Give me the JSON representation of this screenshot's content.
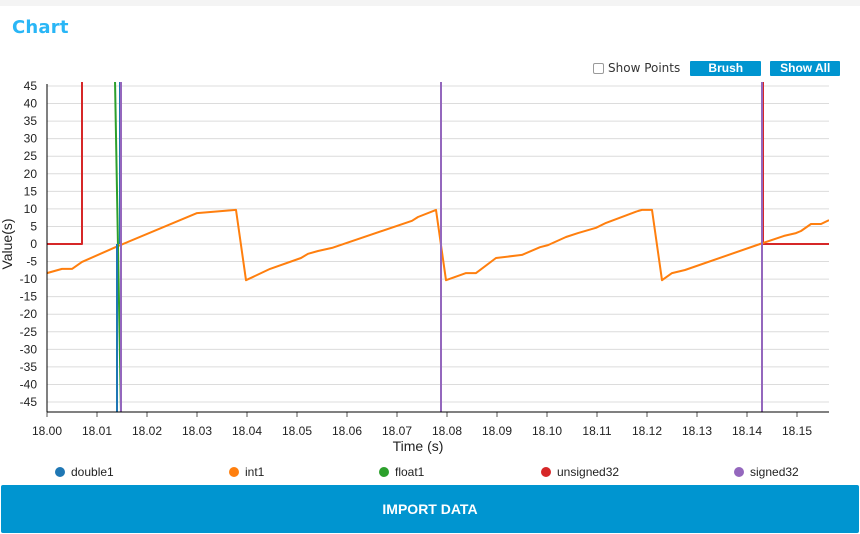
{
  "page": {
    "title": "Chart",
    "controls": {
      "show_points_label": "Show Points",
      "show_points_checked": false,
      "brush_label": "Brush",
      "show_all_label": "Show All"
    },
    "import_button_label": "IMPORT DATA"
  },
  "colors": {
    "accent": "#0095d0",
    "title": "#29b6f6"
  },
  "chart_data": {
    "type": "line",
    "title": "",
    "xlabel": "Time (s)",
    "ylabel": "Value(s)",
    "xlim": [
      18.0,
      18.1564
    ],
    "ylim": [
      -48,
      45
    ],
    "x_ticks": [
      "18.00",
      "18.01",
      "18.02",
      "18.03",
      "18.04",
      "18.05",
      "18.06",
      "18.07",
      "18.08",
      "18.09",
      "18.10",
      "18.11",
      "18.12",
      "18.13",
      "18.14",
      "18.15"
    ],
    "y_ticks": [
      "45",
      "40",
      "35",
      "30",
      "25",
      "20",
      "15",
      "10",
      "5",
      "0",
      "-5",
      "-10",
      "-15",
      "-20",
      "-25",
      "-30",
      "-35",
      "-40",
      "-45"
    ],
    "grid": "horizontal",
    "legend_position": "bottom",
    "series": [
      {
        "name": "double1",
        "color": "#1f77b4",
        "segments": [
          [
            [
              18.014,
              -48
            ],
            [
              18.014,
              0
            ]
          ],
          [
            [
              18.0146,
              0
            ],
            [
              18.0146,
              45
            ]
          ]
        ]
      },
      {
        "name": "int1",
        "color": "#ff7f0e",
        "segments": [
          [
            [
              18.0,
              -8.3
            ],
            [
              18.003,
              -7.1
            ],
            [
              18.005,
              -7.1
            ],
            [
              18.007,
              -5.1
            ],
            [
              18.0142,
              -0.6
            ],
            [
              18.03,
              8.8
            ],
            [
              18.0378,
              9.7
            ],
            [
              18.0398,
              -10.3
            ],
            [
              18.0446,
              -7.1
            ],
            [
              18.0508,
              -4.0
            ],
            [
              18.0522,
              -2.8
            ],
            [
              18.0542,
              -2.0
            ],
            [
              18.057,
              -1.1
            ],
            [
              18.073,
              6.6
            ],
            [
              18.0742,
              7.7
            ],
            [
              18.0778,
              9.7
            ],
            [
              18.0798,
              -10.3
            ],
            [
              18.0838,
              -8.3
            ],
            [
              18.0858,
              -8.3
            ],
            [
              18.0898,
              -4.0
            ],
            [
              18.095,
              -3.1
            ],
            [
              18.0986,
              -0.9
            ],
            [
              18.1002,
              -0.3
            ],
            [
              18.1038,
              2.0
            ],
            [
              18.1062,
              3.1
            ],
            [
              18.1098,
              4.6
            ],
            [
              18.1118,
              6.0
            ],
            [
              18.1182,
              9.4
            ],
            [
              18.119,
              9.7
            ],
            [
              18.121,
              9.7
            ],
            [
              18.123,
              -10.3
            ],
            [
              18.125,
              -8.3
            ],
            [
              18.1276,
              -7.4
            ],
            [
              18.1426,
              0.0
            ],
            [
              18.1474,
              2.3
            ],
            [
              18.1498,
              3.1
            ],
            [
              18.1508,
              3.7
            ],
            [
              18.1528,
              5.7
            ],
            [
              18.1548,
              5.7
            ],
            [
              18.1564,
              6.8
            ]
          ]
        ]
      },
      {
        "name": "float1",
        "color": "#2ca02c",
        "segments": [
          [
            [
              18.0136,
              45
            ],
            [
              18.0148,
              -48
            ]
          ]
        ]
      },
      {
        "name": "unsigned32",
        "color": "#d62728",
        "segments": [
          [
            [
              18.0,
              0
            ],
            [
              18.007,
              0
            ],
            [
              18.007,
              45
            ]
          ],
          [
            [
              18.1432,
              45
            ],
            [
              18.1432,
              0
            ],
            [
              18.1564,
              0
            ]
          ]
        ]
      },
      {
        "name": "signed32",
        "color": "#9467bd",
        "segments": [
          [
            [
              18.0148,
              45
            ],
            [
              18.0148,
              -48
            ]
          ],
          [
            [
              18.0788,
              45
            ],
            [
              18.0788,
              -48
            ]
          ],
          [
            [
              18.143,
              45
            ],
            [
              18.143,
              -48
            ]
          ]
        ]
      }
    ]
  }
}
